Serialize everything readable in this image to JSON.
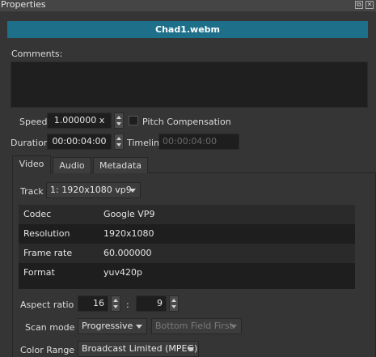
{
  "titlebar": {
    "title": "Properties",
    "float_icon": "float-icon",
    "close_icon": "close-icon"
  },
  "file": {
    "name": "Chad1.webm"
  },
  "comments": {
    "label": "Comments:",
    "value": ""
  },
  "speed": {
    "label": "Speed",
    "value": "1.000000 x",
    "pitch_label": "Pitch Compensation",
    "pitch_checked": false
  },
  "duration": {
    "label": "Duration",
    "value": "00:00:04:00",
    "timeline_label": "Timeline",
    "timeline_value": "00:00:04:00"
  },
  "tabs": [
    {
      "label": "Video",
      "active": true
    },
    {
      "label": "Audio"
    },
    {
      "label": "Metadata"
    }
  ],
  "track": {
    "label": "Track",
    "value": "1: 1920x1080 vp9"
  },
  "info_table": [
    {
      "key": "Codec",
      "value": "Google VP9"
    },
    {
      "key": "Resolution",
      "value": "1920x1080"
    },
    {
      "key": "Frame rate",
      "value": "60.000000"
    },
    {
      "key": "Format",
      "value": "yuv420p"
    }
  ],
  "aspect": {
    "label": "Aspect ratio",
    "num": "16",
    "sep": ":",
    "den": "9"
  },
  "scan": {
    "label": "Scan mode",
    "value": "Progressive",
    "field_order": "Bottom Field First"
  },
  "color_range": {
    "label": "Color Range",
    "value": "Broadcast Limited (MPEG)"
  },
  "colors": {
    "accent": "#1d6f8a",
    "background": "#353535",
    "field": "#1e1e1e"
  }
}
